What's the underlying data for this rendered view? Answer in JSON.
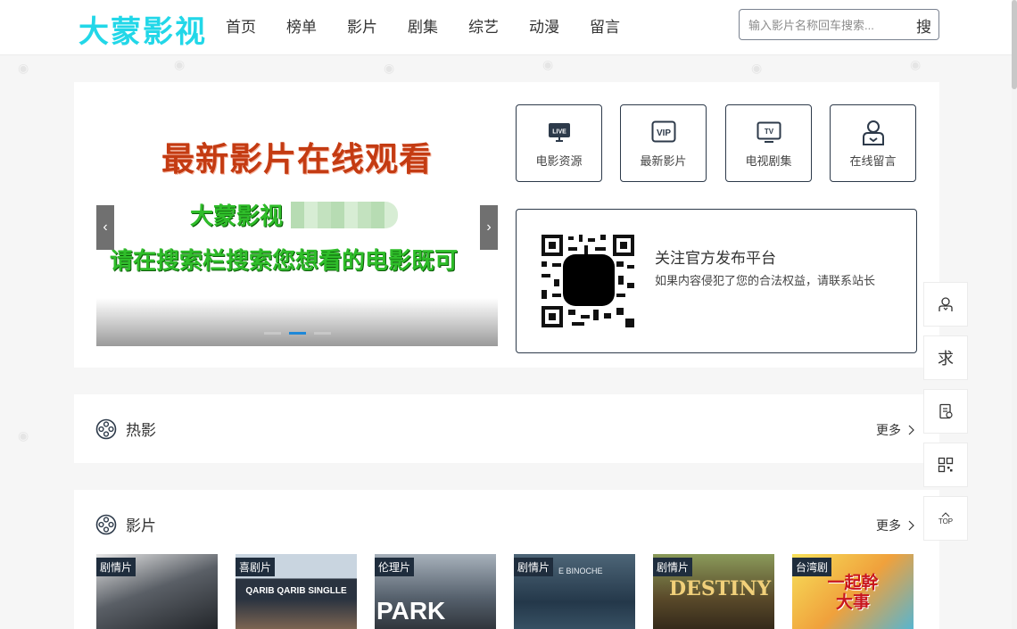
{
  "header": {
    "logo": "大蒙影视",
    "nav": [
      "首页",
      "榜单",
      "影片",
      "剧集",
      "综艺",
      "动漫",
      "留言"
    ],
    "search_placeholder": "输入影片名称回车搜索...",
    "search_button": "搜"
  },
  "banner": {
    "title": "最新影片在线观看",
    "line2": "大蒙影视",
    "line3": "请在搜索栏搜索您想看的电影既可",
    "prev": "‹",
    "next": "›",
    "slide_count": 3,
    "active_slide": 1
  },
  "quick_links": [
    {
      "label": "电影资源",
      "icon": "live-icon"
    },
    {
      "label": "最新影片",
      "icon": "vip-icon"
    },
    {
      "label": "电视剧集",
      "icon": "tv-icon"
    },
    {
      "label": "在线留言",
      "icon": "user-message-icon"
    }
  ],
  "follow": {
    "title": "关注官方发布平台",
    "desc": "如果内容侵犯了您的合法权益，请联系站长"
  },
  "sections": [
    {
      "title": "热影",
      "more": "更多"
    },
    {
      "title": "影片",
      "more": "更多"
    }
  ],
  "posters": [
    {
      "tag": "剧情片",
      "colors": [
        "#4a4f55",
        "#d6d6d6"
      ]
    },
    {
      "tag": "喜剧片",
      "colors": [
        "#b9c6d2",
        "#2a2f38"
      ],
      "text": "QARIB QARIB SINGLLE"
    },
    {
      "tag": "伦理片",
      "colors": [
        "#9aa6b3",
        "#3a3f48"
      ],
      "text": "PARK"
    },
    {
      "tag": "剧情片",
      "colors": [
        "#2a3d4e",
        "#5b6f80"
      ],
      "text": "E BINOCHE"
    },
    {
      "tag": "剧情片",
      "colors": [
        "#6e7a4a",
        "#3a2a1a"
      ],
      "text": "DESTINY"
    },
    {
      "tag": "台湾剧",
      "colors": [
        "#f4d24a",
        "#e07b33"
      ],
      "text": "一起幹大事"
    }
  ],
  "sidebar": [
    "user-icon",
    "求",
    "document-icon",
    "qr-icon",
    "TOP"
  ]
}
